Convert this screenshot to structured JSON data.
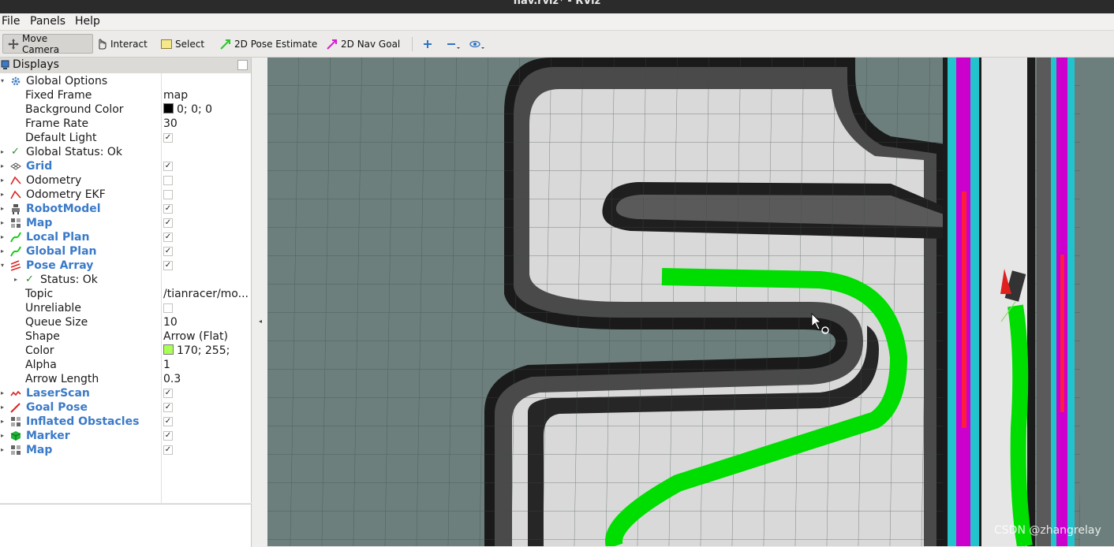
{
  "window": {
    "title": "nav.rviz* - RViz"
  },
  "menu": {
    "file": "File",
    "panels": "Panels",
    "help": "Help"
  },
  "toolbar": {
    "move_camera": "Move Camera",
    "interact": "Interact",
    "select": "Select",
    "pose_estimate": "2D Pose Estimate",
    "nav_goal": "2D Nav Goal"
  },
  "displays": {
    "header": "Displays",
    "rows": [
      {
        "name": "Global Options",
        "value": ""
      },
      {
        "name": "Fixed Frame",
        "value": "map"
      },
      {
        "name": "Background Color",
        "value": "0; 0; 0"
      },
      {
        "name": "Frame Rate",
        "value": "30"
      },
      {
        "name": "Default Light",
        "checked": true
      },
      {
        "name": "Global Status: Ok",
        "value": ""
      },
      {
        "name": "Grid",
        "checked": true
      },
      {
        "name": "Odometry",
        "checked": false
      },
      {
        "name": "Odometry EKF",
        "checked": false
      },
      {
        "name": "RobotModel",
        "checked": true
      },
      {
        "name": "Map",
        "checked": true
      },
      {
        "name": "Local Plan",
        "checked": true
      },
      {
        "name": "Global Plan",
        "checked": true
      },
      {
        "name": "Pose Array",
        "checked": true
      },
      {
        "name": "Status: Ok",
        "value": ""
      },
      {
        "name": "Topic",
        "value": "/tianracer/mo..."
      },
      {
        "name": "Unreliable",
        "checked": false
      },
      {
        "name": "Queue Size",
        "value": "10"
      },
      {
        "name": "Shape",
        "value": "Arrow (Flat)"
      },
      {
        "name": "Color",
        "value": "170; 255;"
      },
      {
        "name": "Alpha",
        "value": "1"
      },
      {
        "name": "Arrow Length",
        "value": "0.3"
      },
      {
        "name": "LaserScan",
        "checked": true
      },
      {
        "name": "Goal Pose",
        "checked": true
      },
      {
        "name": "Inflated Obstacles",
        "checked": true
      },
      {
        "name": "Marker",
        "checked": true
      },
      {
        "name": "Map",
        "checked": true
      }
    ]
  },
  "colors": {
    "background_color": "#000000",
    "pose_color": "#aaff55",
    "path_green": "#00dd00",
    "costmap_magenta": "#cc00cc",
    "costmap_cyan": "#22c3cc",
    "accent_blue": "#3a7ac8"
  },
  "watermark": "CSDN @zhangrelay"
}
